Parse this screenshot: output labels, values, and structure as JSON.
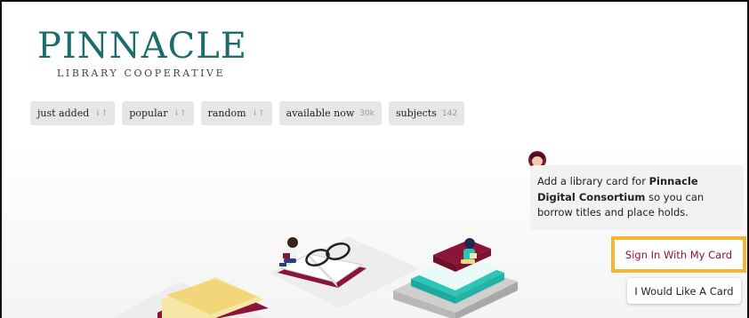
{
  "logo": {
    "main": "PINNACLE",
    "sub": "LIBRARY COOPERATIVE"
  },
  "nav": [
    {
      "label": "just added",
      "suffix": "↓↑"
    },
    {
      "label": "popular",
      "suffix": "↓↑"
    },
    {
      "label": "random",
      "suffix": "↓↑"
    },
    {
      "label": "available now",
      "count": "30k"
    },
    {
      "label": "subjects",
      "count": "142"
    }
  ],
  "prompt": {
    "pre": "Add a library card for ",
    "library": "Pinnacle Digital Consortium",
    "post": " so you can borrow titles and place holds."
  },
  "buttons": {
    "signin": "Sign In With My Card",
    "request": "I Would Like A Card"
  },
  "colors": {
    "brand": "#1d6b6b",
    "accent": "#8a1538",
    "highlight": "#f5b731"
  }
}
